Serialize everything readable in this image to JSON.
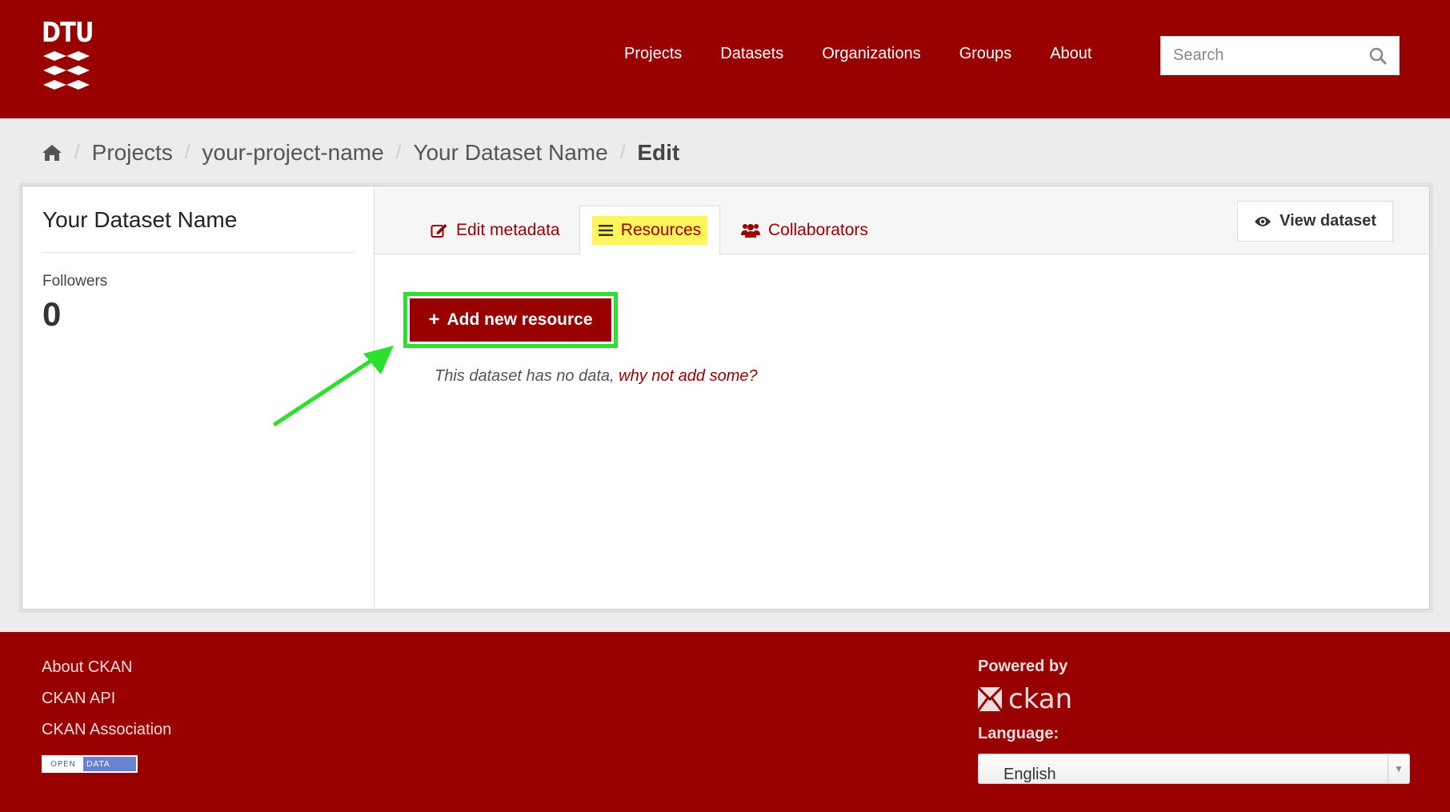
{
  "brand": {
    "logo_text": "DTU"
  },
  "nav": {
    "items": [
      {
        "label": "Projects"
      },
      {
        "label": "Datasets"
      },
      {
        "label": "Organizations"
      },
      {
        "label": "Groups"
      },
      {
        "label": "About"
      }
    ]
  },
  "search": {
    "placeholder": "Search",
    "value": ""
  },
  "breadcrumb": {
    "home_icon": "home-icon",
    "items": [
      "Projects",
      "your-project-name",
      "Your Dataset Name",
      "Edit"
    ],
    "separator": "/"
  },
  "sidebar": {
    "title": "Your Dataset Name",
    "followers_label": "Followers",
    "followers_count": "0"
  },
  "tabs": {
    "edit_metadata": {
      "label": "Edit metadata",
      "icon": "edit-icon"
    },
    "resources": {
      "label": "Resources",
      "icon": "list-icon",
      "active": true
    },
    "collaborators": {
      "label": "Collaborators",
      "icon": "users-icon"
    }
  },
  "view_dataset": {
    "label": "View dataset",
    "icon": "eye-icon"
  },
  "content": {
    "add_resource_label": "Add new resource",
    "empty_text": "This dataset has no data,",
    "empty_link": "why not add some?"
  },
  "footer": {
    "links": [
      "About CKAN",
      "CKAN API",
      "CKAN Association"
    ],
    "open_data_left": "OPEN",
    "open_data_right": "DATA",
    "powered_by": "Powered by",
    "ckan_text": "ckan",
    "language_label": "Language:",
    "language_value": "English"
  },
  "colors": {
    "brand": "#990000",
    "highlight": "#fff45a",
    "annotation": "#2ee02e"
  }
}
